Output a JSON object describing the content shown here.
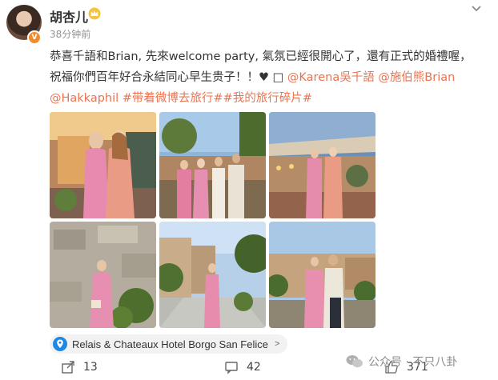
{
  "post": {
    "username": "胡杏儿",
    "time": "38分钟前",
    "text_plain_1": "恭喜千語和Brian, 先來welcome party, 氣氛已經很開心了，還有正式的婚禮喔，祝福你們百年好合永結同心早生贵子！！♥",
    "mention_1": "@Karena吳千語",
    "mention_2": "@施伯熊Brian",
    "mention_3": "@Hakkaphil",
    "tag_1": "#带着微博去旅行#",
    "tag_2": "#我的旅行碎片#"
  },
  "location": {
    "name": "Relais & Chateaux Hotel Borgo San Felice",
    "arrow": ">"
  },
  "actions": {
    "share_count": "13",
    "comment_count": "42",
    "like_count": "371"
  },
  "watermark": {
    "text": "公众号 · 不只八卦"
  },
  "icons": {
    "avatar_badge": "V",
    "vip": "crown-icon",
    "more": "chevron-down-icon",
    "location": "location-pin-icon",
    "share": "share-icon",
    "comment": "comment-icon",
    "like": "thumbs-up-icon"
  },
  "colors": {
    "link": "#eb7350",
    "accent_blue": "#1e88e5",
    "badge": "#f08a2a"
  }
}
